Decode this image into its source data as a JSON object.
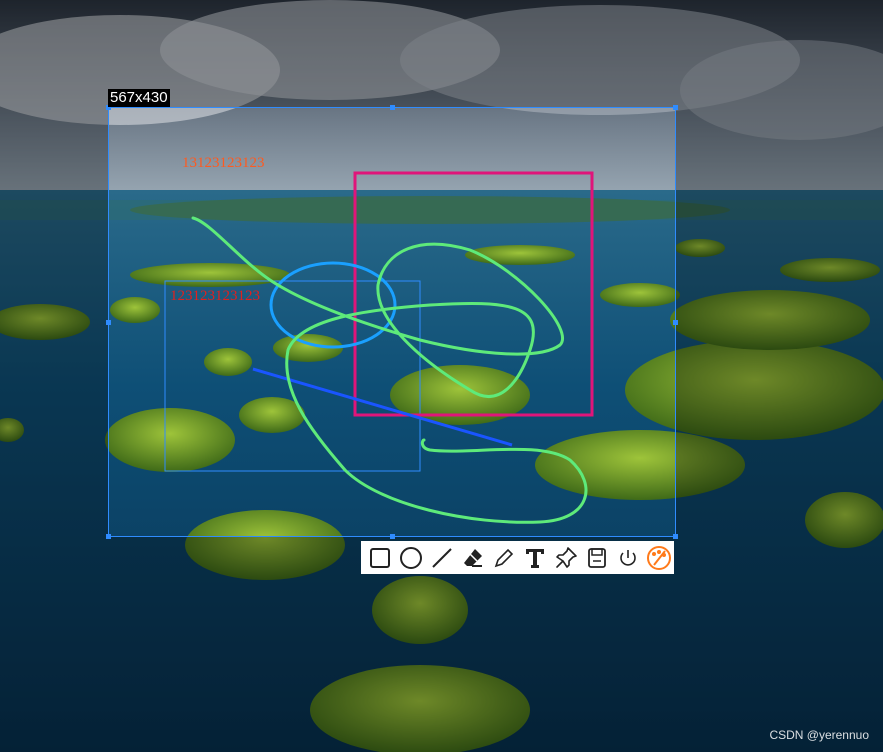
{
  "selection": {
    "size_label": "567x430"
  },
  "annotations": {
    "text1": "13123123123",
    "text2": "123123123123",
    "text1_color": "#ff5a1f",
    "text2_color": "#e0201f",
    "rect_color": "#e0157a",
    "ellipse_color": "#1aa0ff",
    "line_color": "#1a55ff",
    "freehand_color": "#5eea7a"
  },
  "toolbar": {
    "tools": [
      {
        "name": "rectangle-icon"
      },
      {
        "name": "ellipse-icon"
      },
      {
        "name": "line-icon"
      },
      {
        "name": "eraser-icon"
      },
      {
        "name": "pencil-icon"
      },
      {
        "name": "text-icon"
      },
      {
        "name": "pin-icon"
      },
      {
        "name": "save-icon"
      },
      {
        "name": "power-icon"
      },
      {
        "name": "palette-icon",
        "color": "#ff7a1a"
      }
    ]
  },
  "watermark": "CSDN @yerennuo"
}
